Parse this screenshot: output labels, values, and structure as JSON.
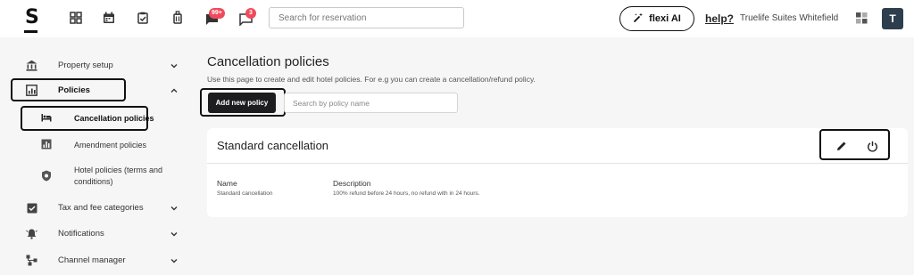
{
  "app": {
    "logo": "S"
  },
  "topbar": {
    "messages_badge": "99+",
    "chat_badge": "3",
    "search_placeholder": "Search for reservation",
    "flexi_label": "flexi AI",
    "help_label": "help?",
    "property_name": "Truelife Suites Whitefield",
    "avatar_initial": "T"
  },
  "sidebar": {
    "items": [
      {
        "label": "Property setup",
        "icon": "bank-icon"
      },
      {
        "label": "Policies",
        "icon": "policy-icon"
      },
      {
        "label": "Tax and fee categories",
        "icon": "checkbox-icon"
      },
      {
        "label": "Notifications",
        "icon": "bell-icon"
      },
      {
        "label": "Channel manager",
        "icon": "network-icon"
      }
    ],
    "sub_items": [
      {
        "label": "Cancellation policies",
        "icon": "bed-icon"
      },
      {
        "label": "Amendment policies",
        "icon": "bar-chart-icon"
      },
      {
        "label": "Hotel policies (terms and conditions)",
        "icon": "shield-icon"
      }
    ]
  },
  "main": {
    "title": "Cancellation policies",
    "description": "Use this page to create and edit hotel policies. For e.g you can create a cancellation/refund policy.",
    "add_button": "Add new policy",
    "search_placeholder": "Search by policy name",
    "policy_card": {
      "title": "Standard cancellation",
      "name_header": "Name",
      "name_value": "Standard cancellation",
      "description_header": "Description",
      "description_value": "100% refund before 24 hours, no refund with in 24 hours."
    }
  }
}
